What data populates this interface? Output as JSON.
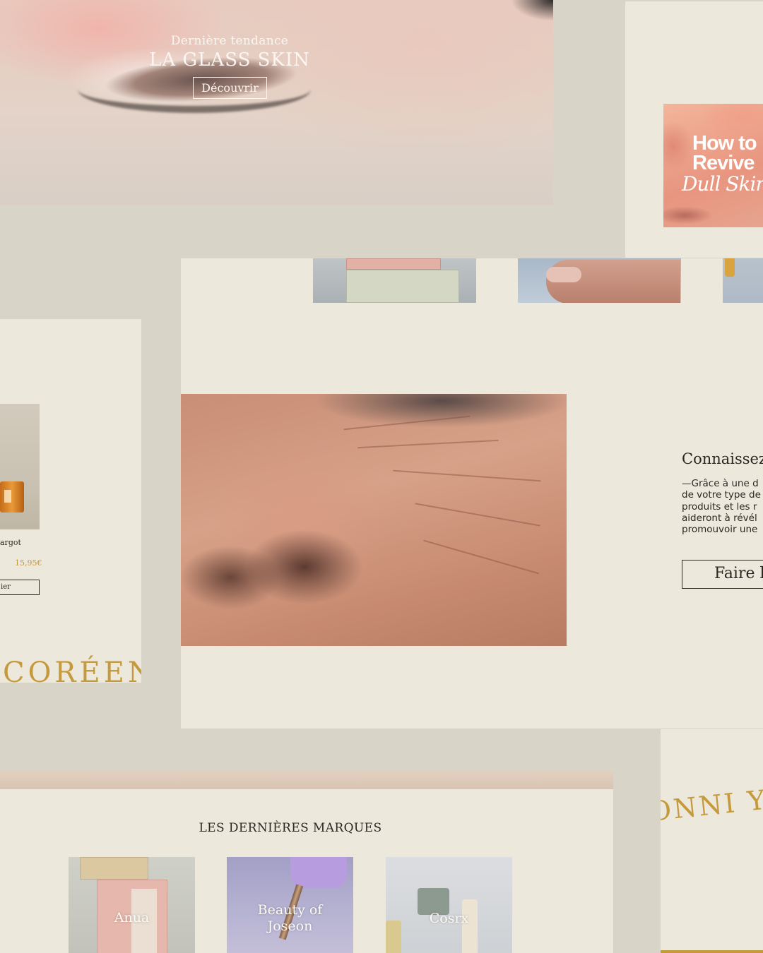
{
  "hero": {
    "kicker": "Dernière tendance",
    "title": "LA GLASS SKIN",
    "cta_label": "Découvrir"
  },
  "dull_skin_card": {
    "line1": "How to",
    "line2": "Revive",
    "line3": "Dull Skin"
  },
  "product_card": {
    "name_fragment": "argot",
    "price": "15,95€",
    "cart_label_fragment": "ier",
    "banner_word_fragment": "CORÉEN"
  },
  "main_card": {
    "heading": "Connaissez",
    "body_lines": [
      "—Grâce à une d",
      "de votre type de",
      "produits et les r",
      "aideront à révél",
      "promouvoir une"
    ],
    "quiz_label": "Faire le"
  },
  "brands": {
    "title": "LES DERNIÈRES MARQUES",
    "items": [
      {
        "label": "Anua"
      },
      {
        "label_line1": "Beauty of",
        "label_line2": "Joseon"
      },
      {
        "label": "Cosrx"
      }
    ]
  },
  "word_card": {
    "text": "ONNI YOU"
  },
  "colors": {
    "background": "#d8d5c8",
    "card": "#ece8dc",
    "accent_gold": "#c49a3c",
    "ink": "#2b2824"
  }
}
